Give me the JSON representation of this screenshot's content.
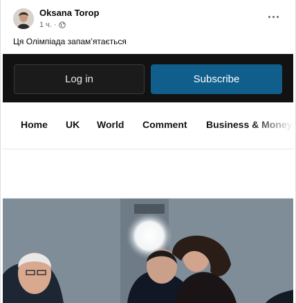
{
  "post": {
    "author": "Oksana Torop",
    "time": "1 ч.",
    "separator": "·",
    "text": "Ця Олімпіада запам’ятається"
  },
  "site": {
    "login_label": "Log in",
    "subscribe_label": "Subscribe",
    "nav": [
      "Home",
      "UK",
      "World",
      "Comment",
      "Business & Money"
    ]
  },
  "colors": {
    "topbar": "#121212",
    "subscribe": "#0f5e8c"
  },
  "icons": {
    "audience": "globe-icon",
    "menu": "more-horizontal-icon"
  }
}
